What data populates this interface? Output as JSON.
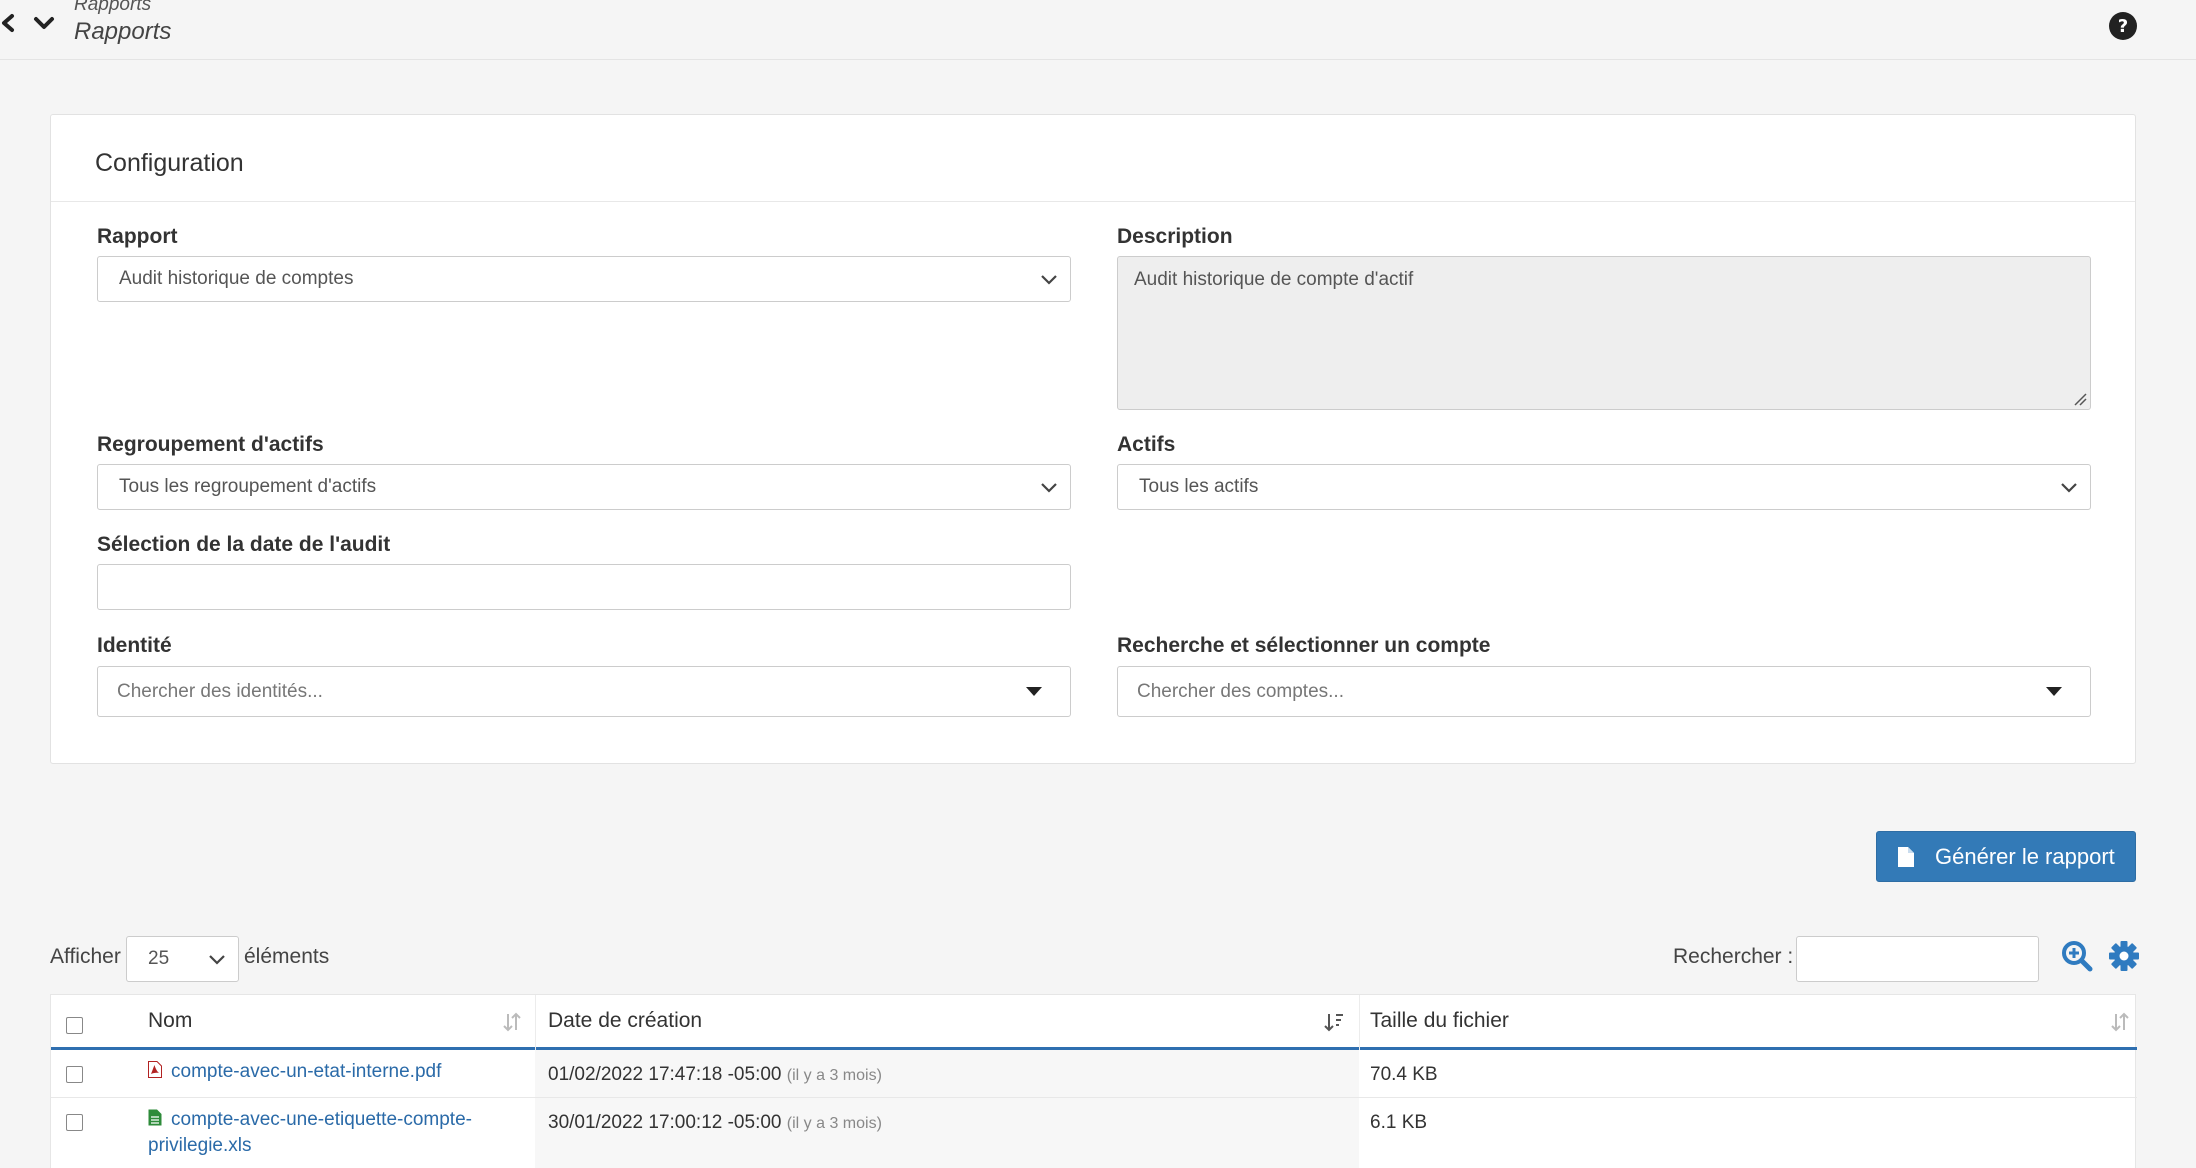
{
  "header": {
    "breadcrumb_small": "Rapports",
    "page_title": "Rapports"
  },
  "config": {
    "title": "Configuration",
    "rapport": {
      "label": "Rapport",
      "value": "Audit historique de comptes"
    },
    "description": {
      "label": "Description",
      "value": "Audit historique de compte d'actif"
    },
    "regroupement": {
      "label": "Regroupement d'actifs",
      "value": "Tous les regroupement d'actifs"
    },
    "actifs": {
      "label": "Actifs",
      "value": "Tous les actifs"
    },
    "date_audit": {
      "label": "Sélection de la date de l'audit",
      "value": ""
    },
    "identite": {
      "label": "Identité",
      "placeholder": "Chercher des identités..."
    },
    "compte": {
      "label": "Recherche et sélectionner un compte",
      "placeholder": "Chercher des comptes..."
    }
  },
  "actions": {
    "generate_label": "Générer le rapport"
  },
  "table_controls": {
    "show_label": "Afficher",
    "page_length": "25",
    "elements_label": "éléments",
    "search_label": "Rechercher :",
    "search_value": ""
  },
  "table": {
    "columns": [
      "Nom",
      "Date de création",
      "Taille du fichier"
    ],
    "rows": [
      {
        "name": "compte-avec-un-etat-interne.pdf",
        "date": "01/02/2022 17:47:18 -05:00",
        "ago": "(il y a 3 mois)",
        "size": "70.4 KB",
        "type": "pdf"
      },
      {
        "name_line1": "compte-avec-une-etiquette-compte-",
        "name_line2": "privilegie.xls",
        "date": "30/01/2022 17:00:12 -05:00",
        "ago": "(il y a 3 mois)",
        "size": "6.1 KB",
        "type": "xls"
      }
    ]
  },
  "colors": {
    "primary": "#337ab7",
    "link": "#2a6aa8",
    "pdf_icon": "#b22222",
    "xls_icon": "#2e8b3a"
  }
}
